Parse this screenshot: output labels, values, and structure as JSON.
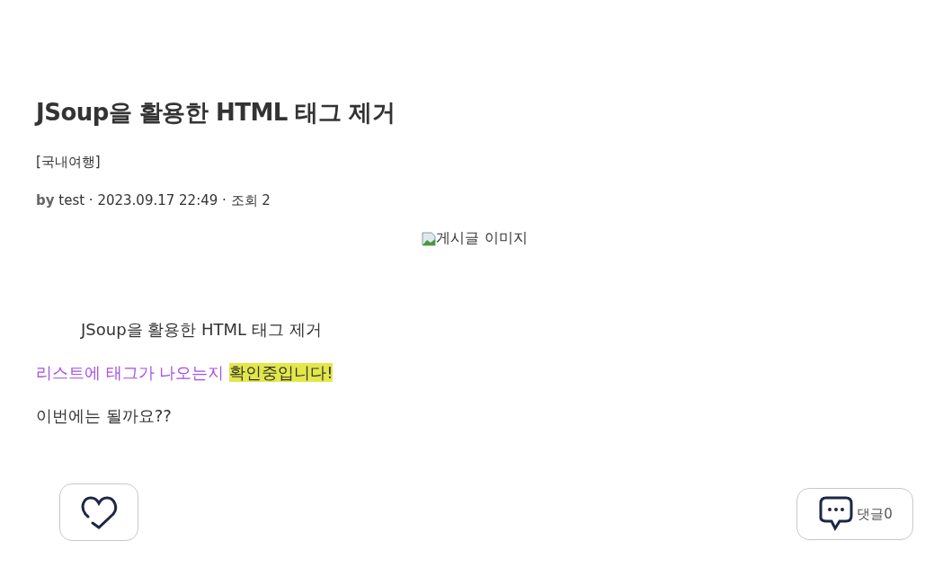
{
  "post": {
    "title": "JSoup을 활용한 HTML 태그 제거",
    "category": "[국내여행]",
    "meta": "**by** test · 2023.09.17 22:49 · 조회 2",
    "image": {
      "alt": "게시글 이미지"
    },
    "paragraphs": [
      {
        "indent": true,
        "segments": [
          {
            "text": "JSoup을 활용한 HTML 태그 제거"
          }
        ]
      },
      {
        "indent": false,
        "segments": [
          {
            "text": "리스트에 태그가 나오는지 ",
            "color": "#a550e6"
          },
          {
            "text": "확인중입니다!",
            "highlighted": true
          }
        ]
      },
      {
        "indent": false,
        "segments": [
          {
            "text": "이번에는 될까요??"
          }
        ]
      }
    ]
  },
  "actions": {
    "like": {
      "liked": false
    },
    "comments": {
      "label": "댓글0"
    }
  }
}
